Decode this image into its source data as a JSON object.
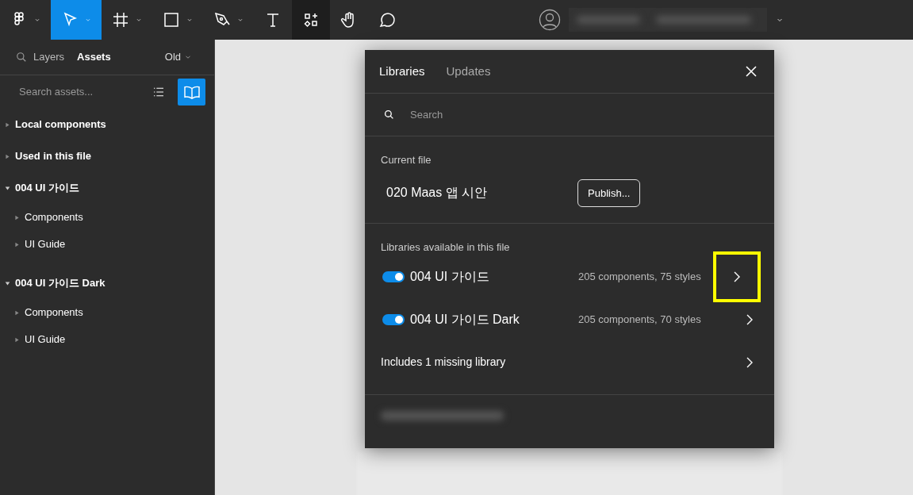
{
  "toolbar": {
    "tools": [
      {
        "kind": "logo",
        "caret": true,
        "selected": false
      },
      {
        "kind": "move",
        "caret": true,
        "selected": true
      },
      {
        "kind": "frame",
        "caret": true,
        "selected": false
      },
      {
        "kind": "rect",
        "caret": true,
        "selected": false
      },
      {
        "kind": "pen",
        "caret": true,
        "selected": false
      },
      {
        "kind": "text",
        "caret": false,
        "selected": false
      },
      {
        "kind": "components",
        "caret": false,
        "active": true,
        "selected": false
      },
      {
        "kind": "hand",
        "caret": false,
        "selected": false
      },
      {
        "kind": "comment",
        "caret": false,
        "selected": false
      }
    ]
  },
  "sidebar": {
    "tabs": [
      {
        "label": "Layers",
        "selected": false
      },
      {
        "label": "Assets",
        "selected": true
      }
    ],
    "version": "Old",
    "search": {
      "placeholder": "Search assets..."
    },
    "sections": [
      {
        "label": "Local components",
        "expanded": false
      },
      {
        "label": "Used in this file",
        "expanded": false
      },
      {
        "label": "004 UI 가이드",
        "expanded": true,
        "children": [
          {
            "label": "Components",
            "expanded": false
          },
          {
            "label": "UI Guide",
            "expanded": false
          }
        ]
      },
      {
        "label": "004 UI 가이드 Dark",
        "expanded": true,
        "children": [
          {
            "label": "Components",
            "expanded": false
          },
          {
            "label": "UI Guide",
            "expanded": false
          }
        ]
      }
    ]
  },
  "dialog": {
    "tabs": [
      {
        "label": "Libraries",
        "selected": true
      },
      {
        "label": "Updates",
        "selected": false
      }
    ],
    "search": {
      "placeholder": "Search"
    },
    "current_file": {
      "heading": "Current file",
      "name": "020 Maas 앱 시안",
      "button": "Publish..."
    },
    "libraries_heading": "Libraries available in this file",
    "libraries": [
      {
        "name": "004 UI 가이드",
        "on": true,
        "stats": "205 components, 75 styles",
        "highlighted": true
      },
      {
        "name": "004 UI 가이드 Dark",
        "on": true,
        "stats": "205 components, 70 styles",
        "highlighted": false
      }
    ],
    "missing": "Includes 1 missing library"
  }
}
